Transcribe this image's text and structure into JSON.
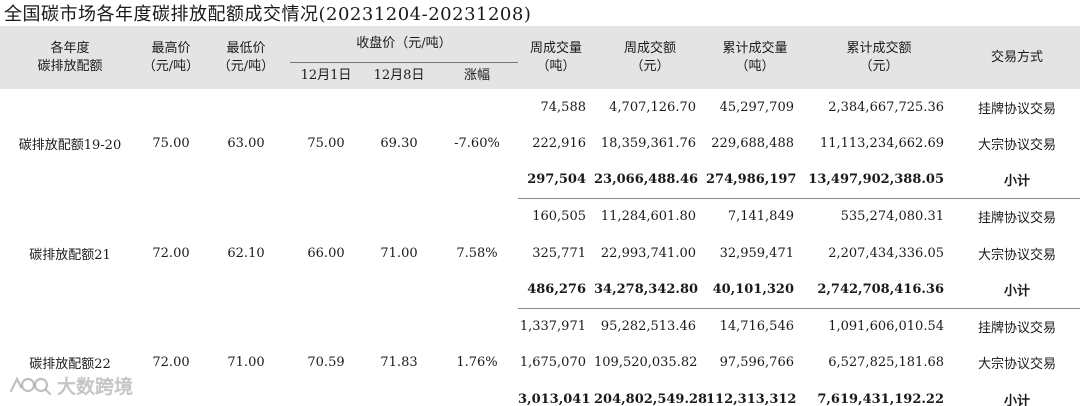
{
  "title": "全国碳市场各年度碳排放配额成交情况(20231204-20231208)",
  "headers": {
    "col1": [
      "各年度",
      "碳排放配额"
    ],
    "col2": [
      "最高价",
      "（元/吨）"
    ],
    "col3": [
      "最低价",
      "（元/吨）"
    ],
    "closing_group": "收盘价（元/吨）",
    "closing_dec1": "12月1日",
    "closing_dec8": "12月8日",
    "change": "涨幅",
    "weekly_vol": [
      "周成交量",
      "（吨）"
    ],
    "weekly_amt": [
      "周成交额",
      "（元）"
    ],
    "cum_vol": [
      "累计成交量",
      "（吨）"
    ],
    "cum_amt": [
      "累计成交额",
      "（元）"
    ],
    "method": "交易方式"
  },
  "groups": [
    {
      "name": "碳排放配额19-20",
      "high": "75.00",
      "low": "63.00",
      "close_dec1": "75.00",
      "close_dec8": "69.30",
      "change": "-7.60%",
      "rows": [
        {
          "weekly_vol": "74,588",
          "weekly_amt": "4,707,126.70",
          "cum_vol": "45,297,709",
          "cum_amt": "2,384,667,725.36",
          "method": "挂牌协议交易"
        },
        {
          "weekly_vol": "222,916",
          "weekly_amt": "18,359,361.76",
          "cum_vol": "229,688,488",
          "cum_amt": "11,113,234,662.69",
          "method": "大宗协议交易"
        },
        {
          "weekly_vol": "297,504",
          "weekly_amt": "23,066,488.46",
          "cum_vol": "274,986,197",
          "cum_amt": "13,497,902,388.05",
          "method": "小计"
        }
      ]
    },
    {
      "name": "碳排放配额21",
      "high": "72.00",
      "low": "62.10",
      "close_dec1": "66.00",
      "close_dec8": "71.00",
      "change": "7.58%",
      "rows": [
        {
          "weekly_vol": "160,505",
          "weekly_amt": "11,284,601.80",
          "cum_vol": "7,141,849",
          "cum_amt": "535,274,080.31",
          "method": "挂牌协议交易"
        },
        {
          "weekly_vol": "325,771",
          "weekly_amt": "22,993,741.00",
          "cum_vol": "32,959,471",
          "cum_amt": "2,207,434,336.05",
          "method": "大宗协议交易"
        },
        {
          "weekly_vol": "486,276",
          "weekly_amt": "34,278,342.80",
          "cum_vol": "40,101,320",
          "cum_amt": "2,742,708,416.36",
          "method": "小计"
        }
      ]
    },
    {
      "name": "碳排放配额22",
      "high": "72.00",
      "low": "71.00",
      "close_dec1": "70.59",
      "close_dec8": "71.83",
      "change": "1.76%",
      "rows": [
        {
          "weekly_vol": "1,337,971",
          "weekly_amt": "95,282,513.46",
          "cum_vol": "14,716,546",
          "cum_amt": "1,091,606,010.54",
          "method": "挂牌协议交易"
        },
        {
          "weekly_vol": "1,675,070",
          "weekly_amt": "109,520,035.82",
          "cum_vol": "97,596,766",
          "cum_amt": "6,527,825,181.68",
          "method": "大宗协议交易"
        },
        {
          "weekly_vol": "3,013,041",
          "weekly_amt": "204,802,549.28",
          "cum_vol": "112,313,312",
          "cum_amt": "7,619,431,192.22",
          "method": "小计"
        }
      ]
    }
  ],
  "watermark": "大数跨境"
}
